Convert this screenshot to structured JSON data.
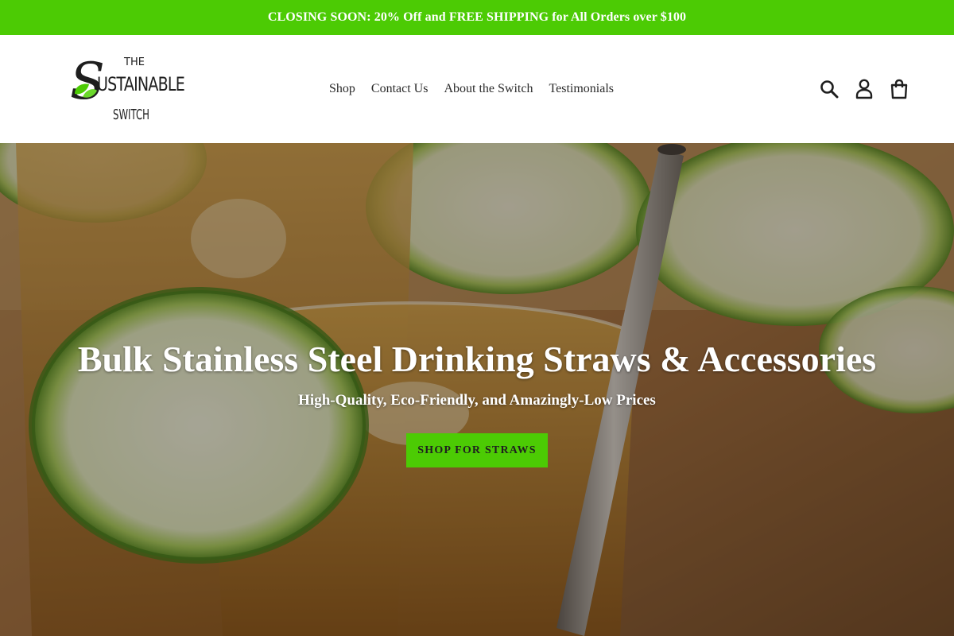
{
  "announcement": {
    "text": "CLOSING SOON: 20% Off and FREE SHIPPING for All Orders over $100",
    "color": "#4ccb04"
  },
  "header": {
    "logo": {
      "line1": "THE",
      "line2": "USTAINABLE",
      "line3": "SWITCH",
      "initial": "S"
    },
    "nav": [
      {
        "label": "Shop"
      },
      {
        "label": "Contact Us"
      },
      {
        "label": "About the Switch"
      },
      {
        "label": "Testimonials"
      }
    ],
    "icons": [
      "search-icon",
      "account-icon",
      "cart-icon"
    ]
  },
  "hero": {
    "title": "Bulk Stainless Steel Drinking Straws & Accessories",
    "subtitle": "High-Quality, Eco-Friendly, and Amazingly-Low Prices",
    "button_label": "SHOP FOR STRAWS",
    "button_color": "#4ccb04"
  }
}
